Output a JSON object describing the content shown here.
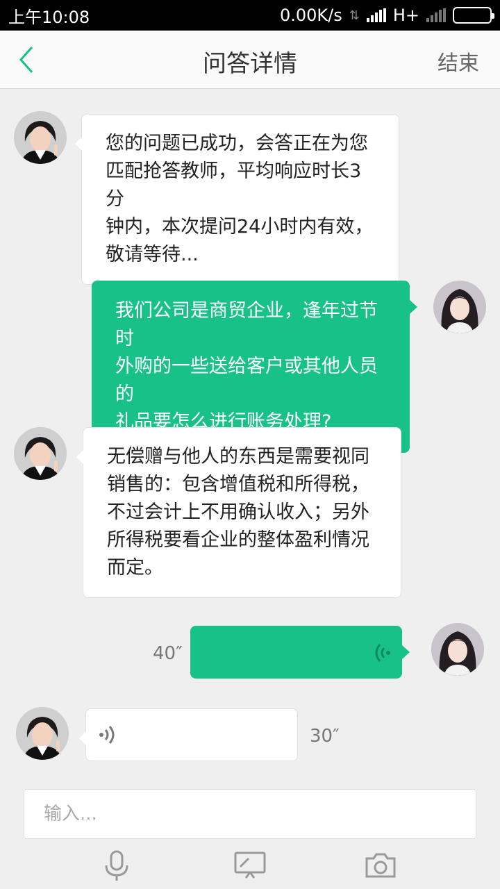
{
  "status_bar": {
    "time": "上午10:08",
    "network_speed": "0.00K/s",
    "network_type": "H+"
  },
  "header": {
    "title": "问答详情",
    "end_label": "结束",
    "back_icon": "chevron-left-icon"
  },
  "messages": [
    {
      "side": "left",
      "sender": "assistant",
      "text": "您的问题已成功，会答正在为您\n匹配抢答教师，平均响应时长3分\n钟内，本次提问24小时内有效，\n敬请等待..."
    },
    {
      "side": "right",
      "sender": "user",
      "text": "我们公司是商贸企业，逢年过节时\n外购的一些送给客户或其他人员的\n礼品要怎么进行账务处理?"
    },
    {
      "side": "left",
      "sender": "teacher",
      "text": "无偿赠与他人的东西是需要视同\n销售的：包含增值税和所得税，\n不过会计上不用确认收入；另外\n所得税要看企业的整体盈利情况\n而定。"
    },
    {
      "side": "right",
      "sender": "user",
      "type": "voice",
      "duration": "40″"
    },
    {
      "side": "left",
      "sender": "teacher",
      "type": "voice",
      "duration": "30″"
    }
  ],
  "composer": {
    "placeholder": "输入...",
    "tools": [
      "microphone-icon",
      "screen-share-icon",
      "camera-icon"
    ]
  },
  "colors": {
    "accent": "#17c188",
    "background": "#efefef"
  }
}
